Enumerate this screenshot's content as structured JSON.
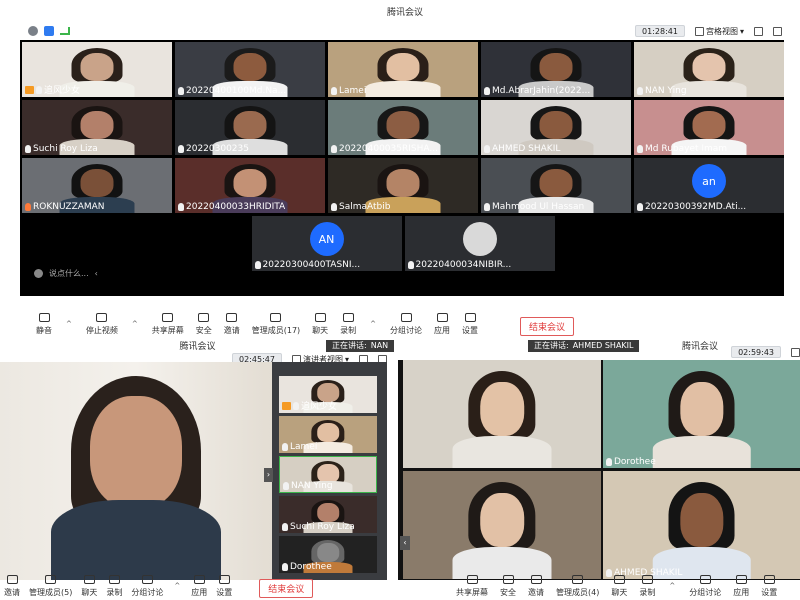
{
  "colors": {
    "meeting_bg": "#000000",
    "tile_bg": "#2b2d31",
    "avatar_blue": "#1e6bff",
    "end_red": "#e03a3a",
    "host_badge": "#f59a23"
  },
  "win1": {
    "title": "腾讯会议",
    "time": "01:28:41",
    "view": "宫格视图",
    "participants": [
      {
        "name": "追风少女",
        "host": true
      },
      {
        "name": "20220400100Md.Na..."
      },
      {
        "name": "Lamei"
      },
      {
        "name": "Md.AbrarJahin(2022..."
      },
      {
        "name": "NAN Ying"
      },
      {
        "name": "Suchi Roy Liza"
      },
      {
        "name": "20220300235"
      },
      {
        "name": "20220400035RISHA..."
      },
      {
        "name": "AHMED SHAKIL"
      },
      {
        "name": "Md Rubayet Imam"
      },
      {
        "name": "ROKNUZZAMAN"
      },
      {
        "name": "20220400033HRIDITA"
      },
      {
        "name": "SalmaAtbib"
      },
      {
        "name": "Mahmood Ul Hassan"
      },
      {
        "name": "20220300392MD.Ati...",
        "avatar": "an"
      },
      {
        "name": "20220300400TASNI...",
        "avatar": "AN"
      },
      {
        "name": "20220400034NIBIR..."
      }
    ],
    "chat_placeholder": "说点什么...",
    "toolbar": [
      {
        "label": "静音",
        "icon": "mic-icon"
      },
      {
        "label": "停止视频",
        "icon": "camera-icon"
      },
      {
        "label": "共享屏幕",
        "icon": "share-screen-icon"
      },
      {
        "label": "安全",
        "icon": "shield-icon"
      },
      {
        "label": "邀请",
        "icon": "invite-icon"
      },
      {
        "label": "管理成员(17)",
        "icon": "members-icon"
      },
      {
        "label": "聊天",
        "icon": "chat-icon"
      },
      {
        "label": "录制",
        "icon": "record-icon"
      },
      {
        "label": "分组讨论",
        "icon": "breakout-icon"
      },
      {
        "label": "应用",
        "icon": "apps-icon"
      },
      {
        "label": "设置",
        "icon": "gear-icon"
      }
    ],
    "end_label": "结束会议"
  },
  "win2": {
    "title": "腾讯会议",
    "time": "02:45:47",
    "view": "演讲者视图",
    "speaker_prefix": "正在讲话:",
    "speaker": "NAN",
    "side_participants": [
      {
        "name": "追风少女",
        "host": true
      },
      {
        "name": "Lamei"
      },
      {
        "name": "NAN Ying"
      },
      {
        "name": "Suchi Roy Liza"
      },
      {
        "name": "Dorothee"
      }
    ],
    "toolbar": [
      {
        "label": "邀请",
        "icon": "invite-icon"
      },
      {
        "label": "管理成员(5)",
        "icon": "members-icon"
      },
      {
        "label": "聊天",
        "icon": "chat-icon"
      },
      {
        "label": "录制",
        "icon": "record-icon"
      },
      {
        "label": "分组讨论",
        "icon": "breakout-icon"
      },
      {
        "label": "应用",
        "icon": "apps-icon"
      },
      {
        "label": "设置",
        "icon": "gear-icon"
      }
    ],
    "end_label": "结束会议"
  },
  "win3": {
    "title": "腾讯会议",
    "time": "02:59:43",
    "speaker_prefix": "正在讲话:",
    "speaker": "AHMED SHAKIL",
    "tiles": [
      {
        "name": ""
      },
      {
        "name": "Dorothee"
      },
      {
        "name": ""
      },
      {
        "name": "AHMED SHAKIL"
      }
    ],
    "toolbar": [
      {
        "label": "共享屏幕",
        "icon": "share-screen-icon"
      },
      {
        "label": "安全",
        "icon": "shield-icon"
      },
      {
        "label": "邀请",
        "icon": "invite-icon"
      },
      {
        "label": "管理成员(4)",
        "icon": "members-icon"
      },
      {
        "label": "聊天",
        "icon": "chat-icon"
      },
      {
        "label": "录制",
        "icon": "record-icon"
      },
      {
        "label": "分组讨论",
        "icon": "breakout-icon"
      },
      {
        "label": "应用",
        "icon": "apps-icon"
      },
      {
        "label": "设置",
        "icon": "gear-icon"
      }
    ]
  }
}
